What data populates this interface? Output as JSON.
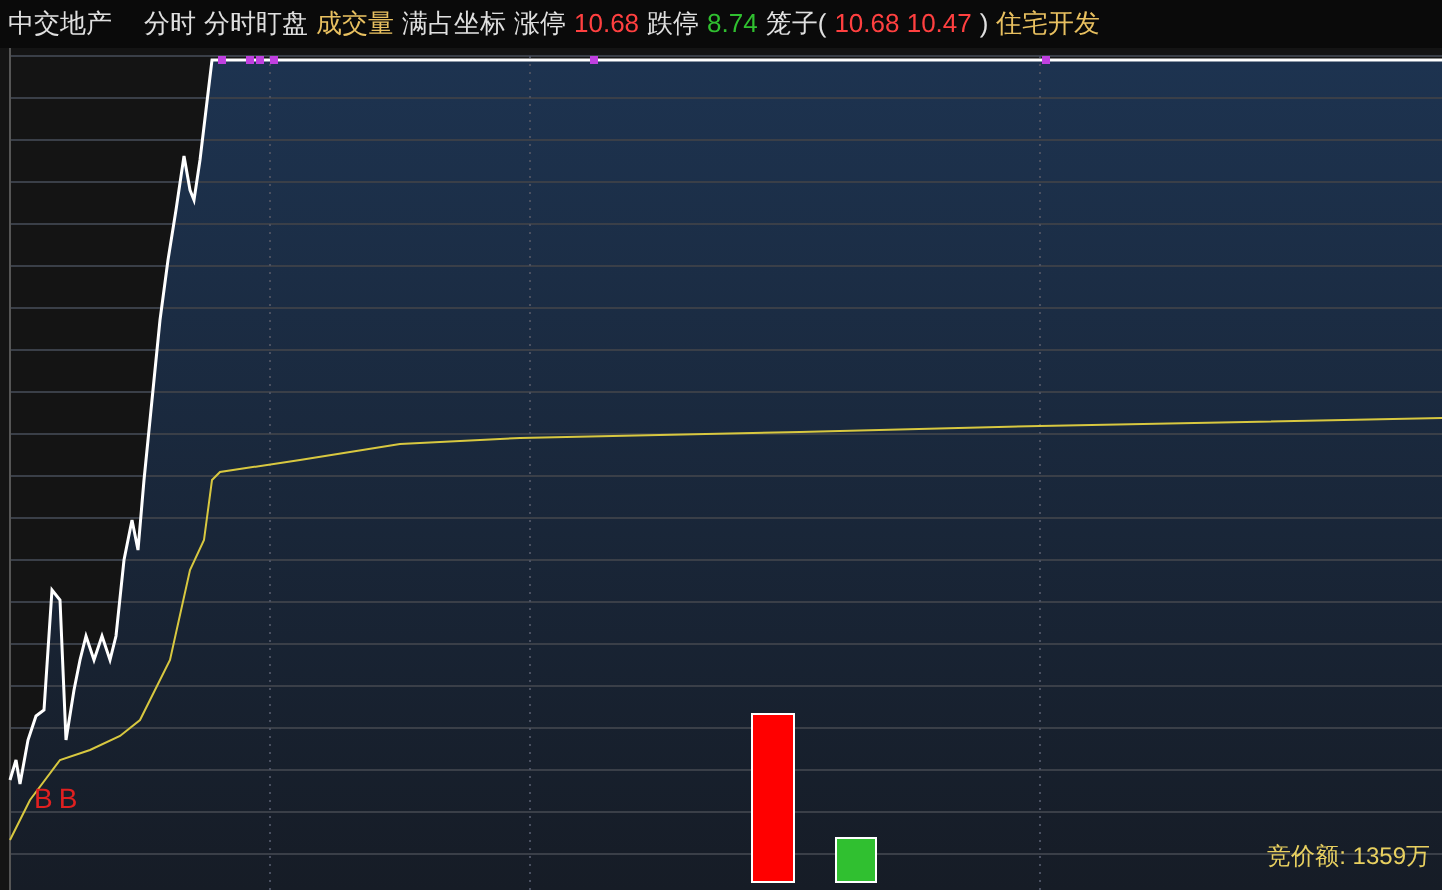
{
  "header": [
    {
      "kind": "title",
      "text": "中交地产"
    },
    {
      "kind": "plain",
      "text": "分时"
    },
    {
      "kind": "plain",
      "text": "分时盯盘"
    },
    {
      "kind": "gold",
      "text": "成交量"
    },
    {
      "kind": "plain",
      "text": "满占坐标"
    },
    {
      "kind": "plain",
      "text": "涨停"
    },
    {
      "kind": "up",
      "text": "10.68"
    },
    {
      "kind": "plain",
      "text": "跌停"
    },
    {
      "kind": "down",
      "text": "8.74"
    },
    {
      "kind": "plain",
      "text": "笼子("
    },
    {
      "kind": "up",
      "text": "10.68 10.47"
    },
    {
      "kind": "plain",
      "text": ")"
    },
    {
      "kind": "gold",
      "text": "住宅开发"
    }
  ],
  "chart": {
    "signals": [
      "B",
      "B"
    ],
    "auction": "竞价额: 1359万"
  }
}
